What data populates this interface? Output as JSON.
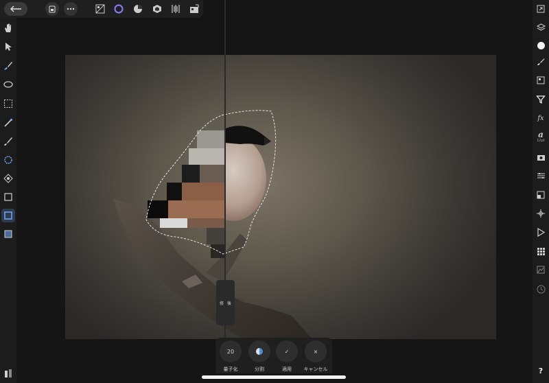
{
  "toolbar": {
    "back_icon": "arrow-left-icon",
    "icons": [
      "document-icon",
      "more-icon",
      "pixel-persona-icon",
      "photo-persona-icon",
      "develop-persona-icon",
      "tone-map-persona-icon",
      "liquify-persona-icon",
      "export-persona-icon"
    ]
  },
  "left_tools": [
    "hand-icon",
    "move-icon",
    "brush-icon",
    "lasso-icon",
    "marquee-icon",
    "wand-icon",
    "paint-icon",
    "smudge-icon",
    "clone-icon",
    "crop-icon",
    "rect-select-icon",
    "layer-icon"
  ],
  "right_tools": [
    "navigator-icon",
    "layers-icon",
    "color-icon",
    "brush-studio-icon",
    "adjust-icon",
    "filter-icon",
    "fx-icon",
    "text-icon",
    "camera-icon",
    "settings-icon",
    "blend-icon",
    "transform-icon",
    "play-icon",
    "grid-icon",
    "histogram-icon",
    "history-icon",
    "help-icon"
  ],
  "right_text": {
    "fx": "fx",
    "text_style": "a",
    "text_size": "12pt",
    "help": "?"
  },
  "split_handle": {
    "left": "修",
    "right": "後"
  },
  "context": {
    "quantize_value": "20",
    "quantize_label": "量子化",
    "split_label": "分割",
    "apply_label": "適用",
    "cancel_label": "キャンセル",
    "apply_icon": "✓",
    "cancel_icon": "×"
  },
  "colors": {
    "accent": "#4a90e2",
    "active_tool": "#2d3a4f",
    "toolbar_bg": "#1f1f1f"
  }
}
